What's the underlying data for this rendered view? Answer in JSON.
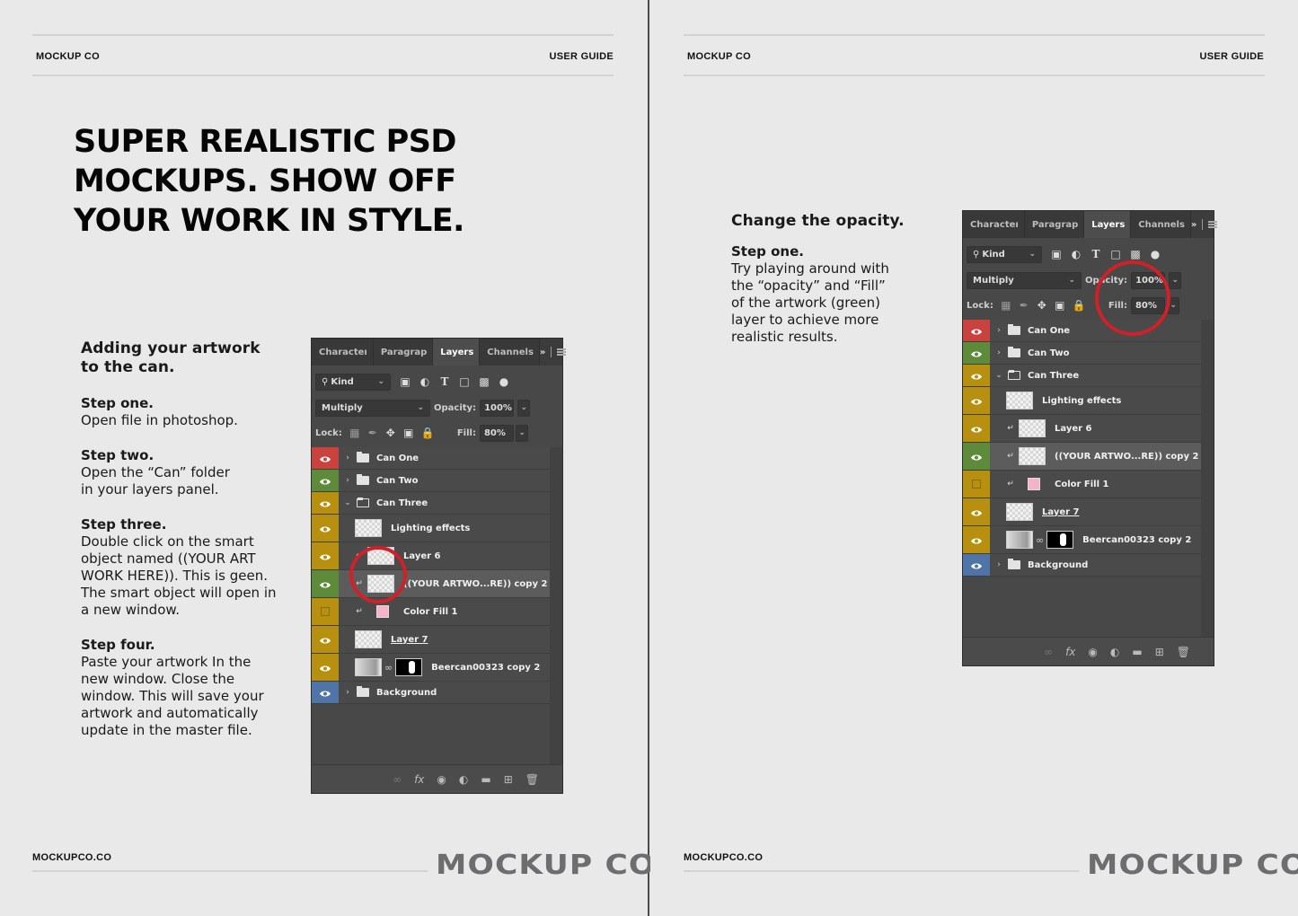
{
  "pages": [
    {
      "header": {
        "brand": "MOCKUP CO",
        "section": "USER GUIDE"
      },
      "headline": "SUPER REALISTIC PSD\nMOCKUPS. SHOW OFF\nYOUR WORK IN STYLE.",
      "instructions": {
        "title_line1": "Adding your artwork",
        "title_line2": "to the can.",
        "steps": [
          {
            "title": "Step one.",
            "body": [
              "Open file in photoshop."
            ]
          },
          {
            "title": "Step two.",
            "body": [
              "Open the “Can” folder",
              "in your layers panel."
            ]
          },
          {
            "title": "Step three.",
            "body": [
              "Double click on the smart",
              "object named ((YOUR ART",
              "WORK HERE)). This is geen.",
              "The smart object will open in",
              "a new window."
            ]
          },
          {
            "title": "Step four.",
            "body": [
              "Paste your artwork In the",
              "new window. Close the",
              "window. This will save your",
              "artwork and automatically",
              "update in the master file."
            ]
          }
        ]
      },
      "footer": {
        "url": "MOCKUPCO.CO",
        "logo": "MOCKUP CO."
      }
    },
    {
      "header": {
        "brand": "MOCKUP CO",
        "section": "USER GUIDE"
      },
      "instructions": {
        "title": "Change the opacity.",
        "steps": [
          {
            "title": "Step one.",
            "body": [
              "Try playing around with",
              "the “opacity” and “Fill”",
              "of the artwork (green)",
              "layer to achieve more",
              "realistic results."
            ]
          }
        ]
      },
      "footer": {
        "url": "MOCKUPCO.CO",
        "logo": "MOCKUP CO."
      }
    }
  ],
  "layers_panel": {
    "tabs": [
      "Characteı",
      "Paragrap",
      "Layers",
      "Channels"
    ],
    "active_tab": "Layers",
    "overflow": "»",
    "filter_kind": "Kind",
    "blend_mode": "Multiply",
    "opacity_label": "Opacity:",
    "opacity_value": "100%",
    "lock_label": "Lock:",
    "fill_label": "Fill:",
    "fill_value": "80%",
    "layers": [
      {
        "name": "Can One",
        "type": "folder",
        "color": "#c9423e",
        "visible": true
      },
      {
        "name": "Can Two",
        "type": "folder",
        "color": "#5e8b3a",
        "visible": true
      },
      {
        "name": "Can Three",
        "type": "folder-open",
        "color": "#b8900f",
        "visible": true
      },
      {
        "name": "Lighting effects",
        "type": "layer",
        "color": "#b8900f",
        "visible": true
      },
      {
        "name": "Layer 6",
        "type": "clipped",
        "color": "#b8900f",
        "visible": true
      },
      {
        "name": "((YOUR ARTWO...RE)) copy 2",
        "type": "smart-object",
        "color": "#5e8b3a",
        "visible": true,
        "selected": true
      },
      {
        "name": "Color Fill 1",
        "type": "fill",
        "color": "#b8900f",
        "visible": false
      },
      {
        "name": "Layer 7",
        "type": "layer",
        "color": "#b8900f",
        "visible": true
      },
      {
        "name": "Beercan00323 copy 2",
        "type": "masked",
        "color": "#b8900f",
        "visible": true
      },
      {
        "name": "Background",
        "type": "folder",
        "color": "#4f74a8",
        "visible": true
      }
    ],
    "footer_icons": [
      "link-icon",
      "fx-icon",
      "mask-icon",
      "adjustment-icon",
      "new-group-icon",
      "new-layer-icon",
      "trash-icon"
    ]
  },
  "colors": {
    "highlight_circle": "#d0202a",
    "page_bg": "#e9e9e9",
    "logo": "#6d6d70"
  }
}
